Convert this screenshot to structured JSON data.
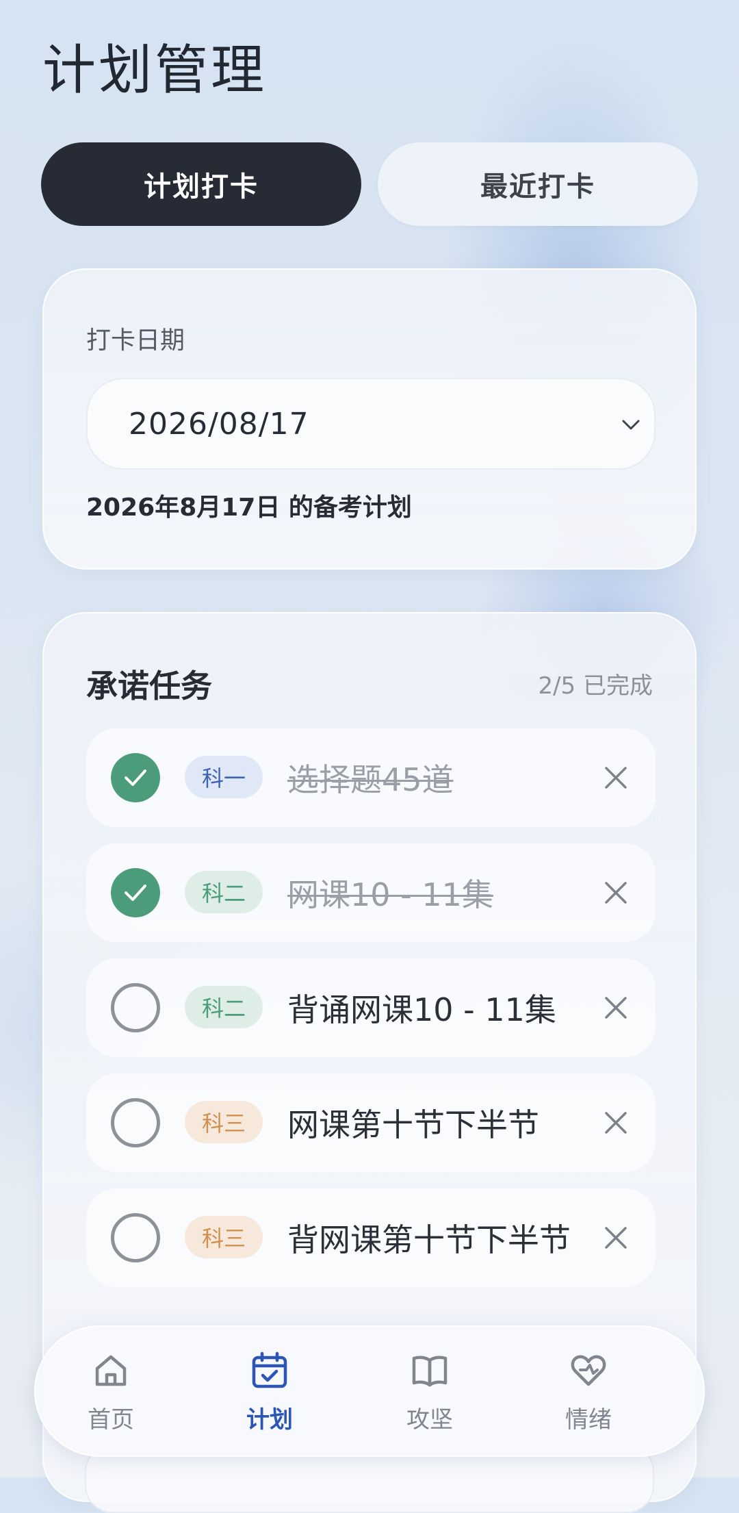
{
  "page": {
    "title": "计划管理"
  },
  "tabs": [
    {
      "label": "计划打卡",
      "active": true
    },
    {
      "label": "最近打卡",
      "active": false
    }
  ],
  "date_card": {
    "label": "打卡日期",
    "date_value": "2026/08/17",
    "caption": "2026年8月17日 的备考计划",
    "dropdown_icon": "chevron-down-icon"
  },
  "tasks": {
    "title": "承诺任务",
    "progress": "2/5 已完成",
    "items": [
      {
        "tag": "科一",
        "text": "选择题45道",
        "done": true
      },
      {
        "tag": "科二",
        "text": "网课10 - 11集",
        "done": true
      },
      {
        "tag": "科二",
        "text": "背诵网课10 - 11集",
        "done": false
      },
      {
        "tag": "科三",
        "text": "网课第十节下半节",
        "done": false
      },
      {
        "tag": "科三",
        "text": "背网课第十节下半节",
        "done": false
      }
    ]
  },
  "nav": {
    "items": [
      {
        "label": "首页",
        "icon": "home-icon",
        "active": false
      },
      {
        "label": "计划",
        "icon": "calendar-check-icon",
        "active": true
      },
      {
        "label": "攻坚",
        "icon": "book-open-icon",
        "active": false
      },
      {
        "label": "情绪",
        "icon": "heart-icon",
        "active": false
      }
    ]
  },
  "colors": {
    "active_tab": "#262b35",
    "done_check": "#4b9c7a",
    "nav_active": "#2c55b8",
    "tag_ke1_bg": "#e0e8f7",
    "tag_ke1_text": "#3f63b3",
    "tag_ke2_bg": "#deeee7",
    "tag_ke2_text": "#4b9c7a",
    "tag_ke3_bg": "#f6e9dc",
    "tag_ke3_text": "#d08f4e"
  }
}
